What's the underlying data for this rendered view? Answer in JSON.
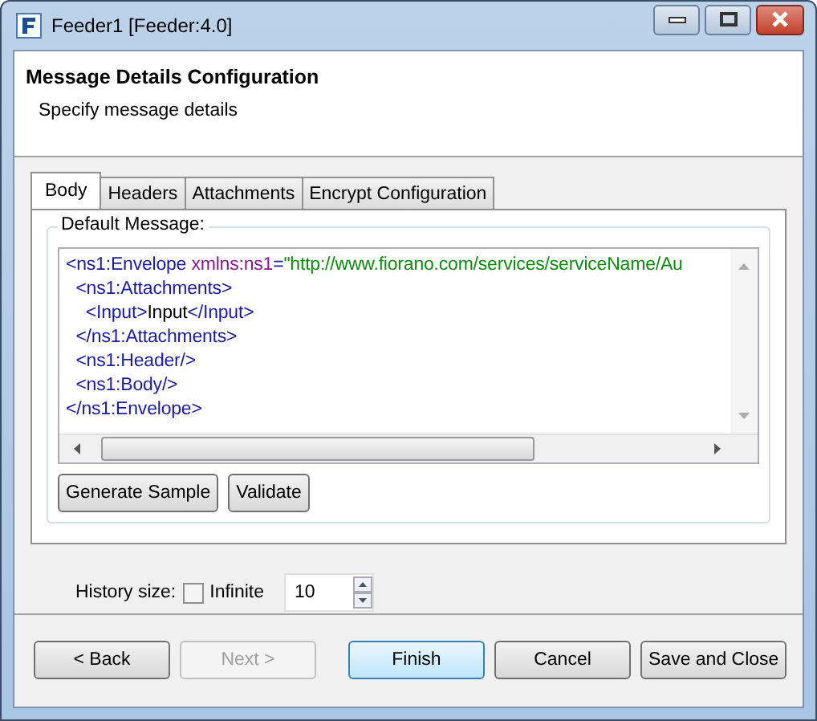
{
  "window": {
    "title": "Feeder1 [Feeder:4.0]"
  },
  "header": {
    "title": "Message Details Configuration",
    "subtitle": "Specify message details"
  },
  "tabs": [
    {
      "label": "Body",
      "selected": true
    },
    {
      "label": "Headers",
      "selected": false
    },
    {
      "label": "Attachments",
      "selected": false
    },
    {
      "label": "Encrypt Configuration",
      "selected": false
    }
  ],
  "default_message": {
    "label": "Default Message:",
    "lines": [
      [
        {
          "kind": "tag",
          "text": "<ns1:Envelope "
        },
        {
          "kind": "attr",
          "text": "xmlns:ns1"
        },
        {
          "kind": "tag",
          "text": "="
        },
        {
          "kind": "value",
          "text": "\"http://www.fiorano.com/services/serviceName/Au"
        }
      ],
      [
        {
          "kind": "tag",
          "text": "  <ns1:Attachments>"
        }
      ],
      [
        {
          "kind": "tag",
          "text": "    <Input>"
        },
        {
          "kind": "text",
          "text": "Input"
        },
        {
          "kind": "tag",
          "text": "</Input>"
        }
      ],
      [
        {
          "kind": "tag",
          "text": "  </ns1:Attachments>"
        }
      ],
      [
        {
          "kind": "tag",
          "text": "  <ns1:Header/>"
        }
      ],
      [
        {
          "kind": "tag",
          "text": "  <ns1:Body/>"
        }
      ],
      [
        {
          "kind": "tag",
          "text": "</ns1:Envelope>"
        }
      ]
    ]
  },
  "panel_buttons": [
    "Generate Sample",
    "Validate"
  ],
  "history": {
    "label": "History size:",
    "infinite_label": "Infinite",
    "infinite_checked": false,
    "value": "10"
  },
  "buttons": [
    {
      "label": "< Back",
      "disabled": false,
      "default": false
    },
    {
      "label": "Next >",
      "disabled": true,
      "default": false
    },
    {
      "label": "Finish",
      "disabled": false,
      "default": true
    },
    {
      "label": "Cancel",
      "disabled": false,
      "default": false
    },
    {
      "label": "Save and Close",
      "disabled": false,
      "default": false
    }
  ]
}
